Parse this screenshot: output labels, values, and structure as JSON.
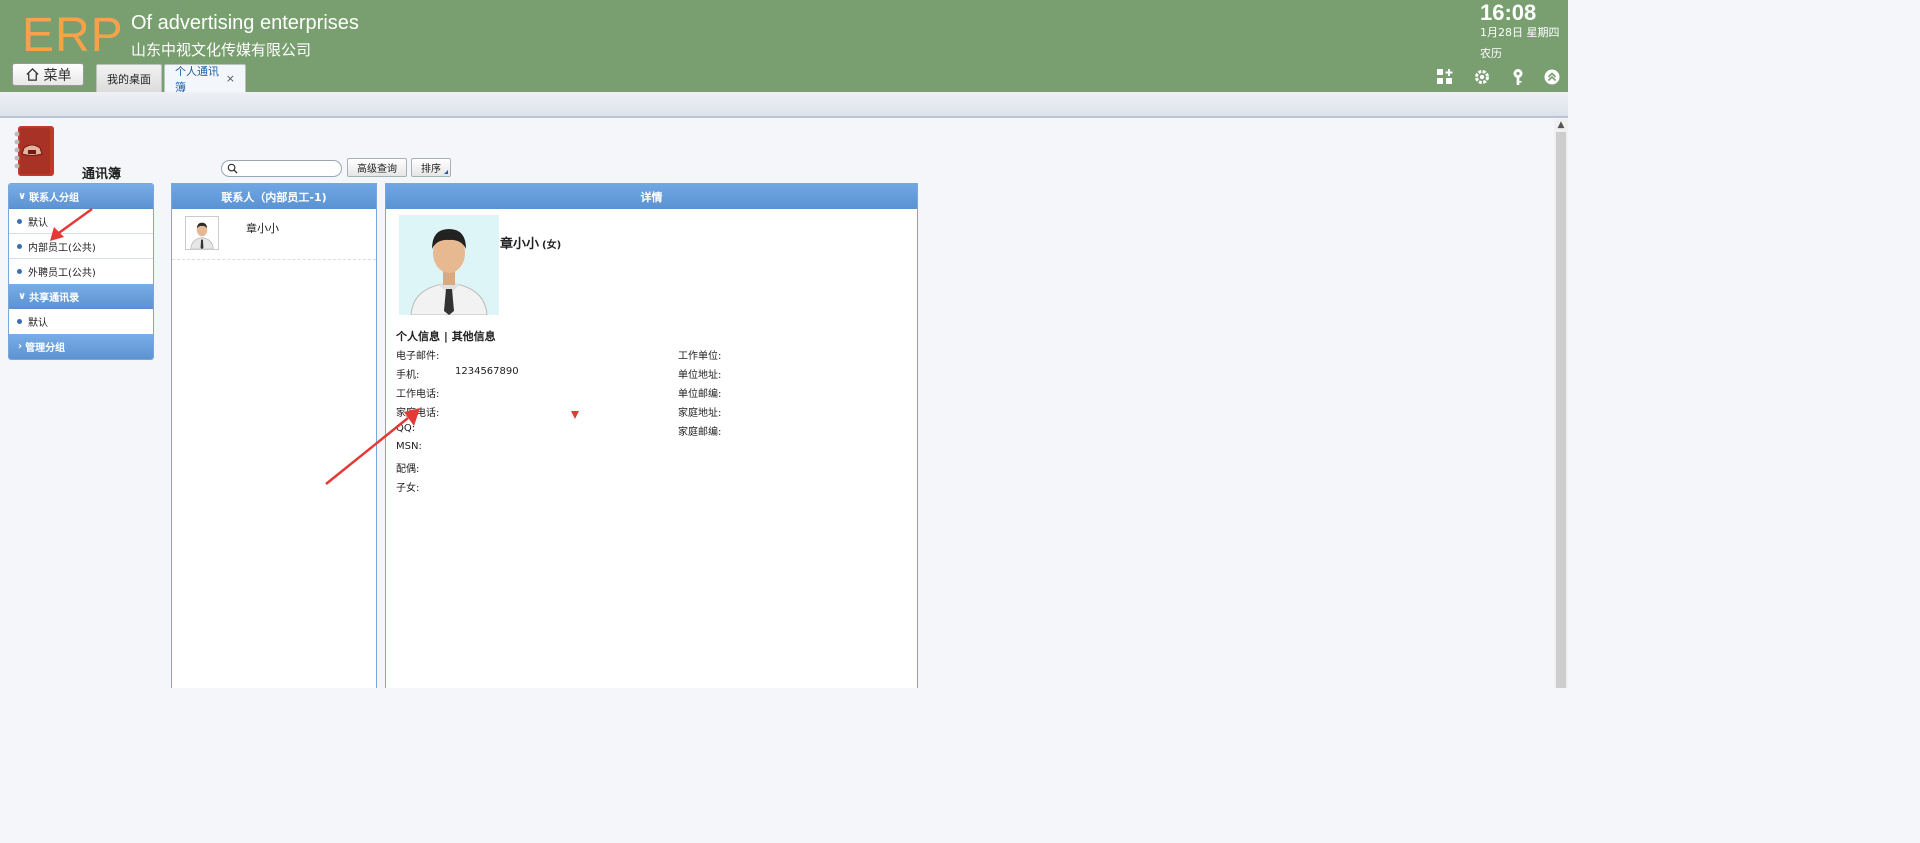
{
  "header": {
    "logo": "ERP",
    "subtitle_en": "Of advertising enterprises",
    "subtitle_cn": "山东中视文化传媒有限公司",
    "menu_label": "菜单",
    "clock": "16:08",
    "date": "1月28日 星期四",
    "lunar": "农历",
    "tabs": [
      {
        "label": "我的桌面"
      },
      {
        "label": "个人通讯簿",
        "close": "×"
      }
    ],
    "tool_icons": [
      "add-widget-icon",
      "settings-gear-icon",
      "key-icon",
      "collapse-up-icon"
    ]
  },
  "page": {
    "title": "通讯簿"
  },
  "toolbar": {
    "search_placeholder": "",
    "advanced_search_label": "高级查询",
    "sort_label": "排序"
  },
  "nav": {
    "groups": [
      {
        "label": "联系人分组",
        "items": [
          "默认",
          "内部员工(公共)",
          "外聘员工(公共)"
        ]
      },
      {
        "label": "共享通讯录",
        "items": [
          "默认"
        ]
      },
      {
        "label": "管理分组",
        "items": []
      }
    ]
  },
  "contacts": {
    "header": "联系人（内部员工-1)",
    "list": [
      {
        "name": "章小小"
      }
    ]
  },
  "details": {
    "header": "详情",
    "name": "章小小",
    "gender": "(女)",
    "tab_personal": "个人信息",
    "tab_separator": " | ",
    "tab_other": "其他信息",
    "left_fields": [
      {
        "label": "电子邮件:",
        "value": ""
      },
      {
        "label": "手机:",
        "value": "1234567890"
      },
      {
        "label": "工作电话:",
        "value": ""
      },
      {
        "label": "家庭电话:",
        "value": ""
      },
      {
        "label": "QQ:",
        "value": ""
      },
      {
        "label": "MSN:",
        "value": ""
      },
      {
        "label": "配偶:",
        "value": ""
      },
      {
        "label": "子女:",
        "value": ""
      }
    ],
    "right_fields": [
      {
        "label": "工作单位:",
        "value": ""
      },
      {
        "label": "单位地址:",
        "value": ""
      },
      {
        "label": "单位邮编:",
        "value": ""
      },
      {
        "label": "家庭地址:",
        "value": ""
      },
      {
        "label": "家庭邮编:",
        "value": ""
      }
    ]
  },
  "colors": {
    "header_bg": "#799f71",
    "logo": "#f7a24a",
    "panel_header": "#5b92d2",
    "annotation_arrow": "#e53935"
  }
}
